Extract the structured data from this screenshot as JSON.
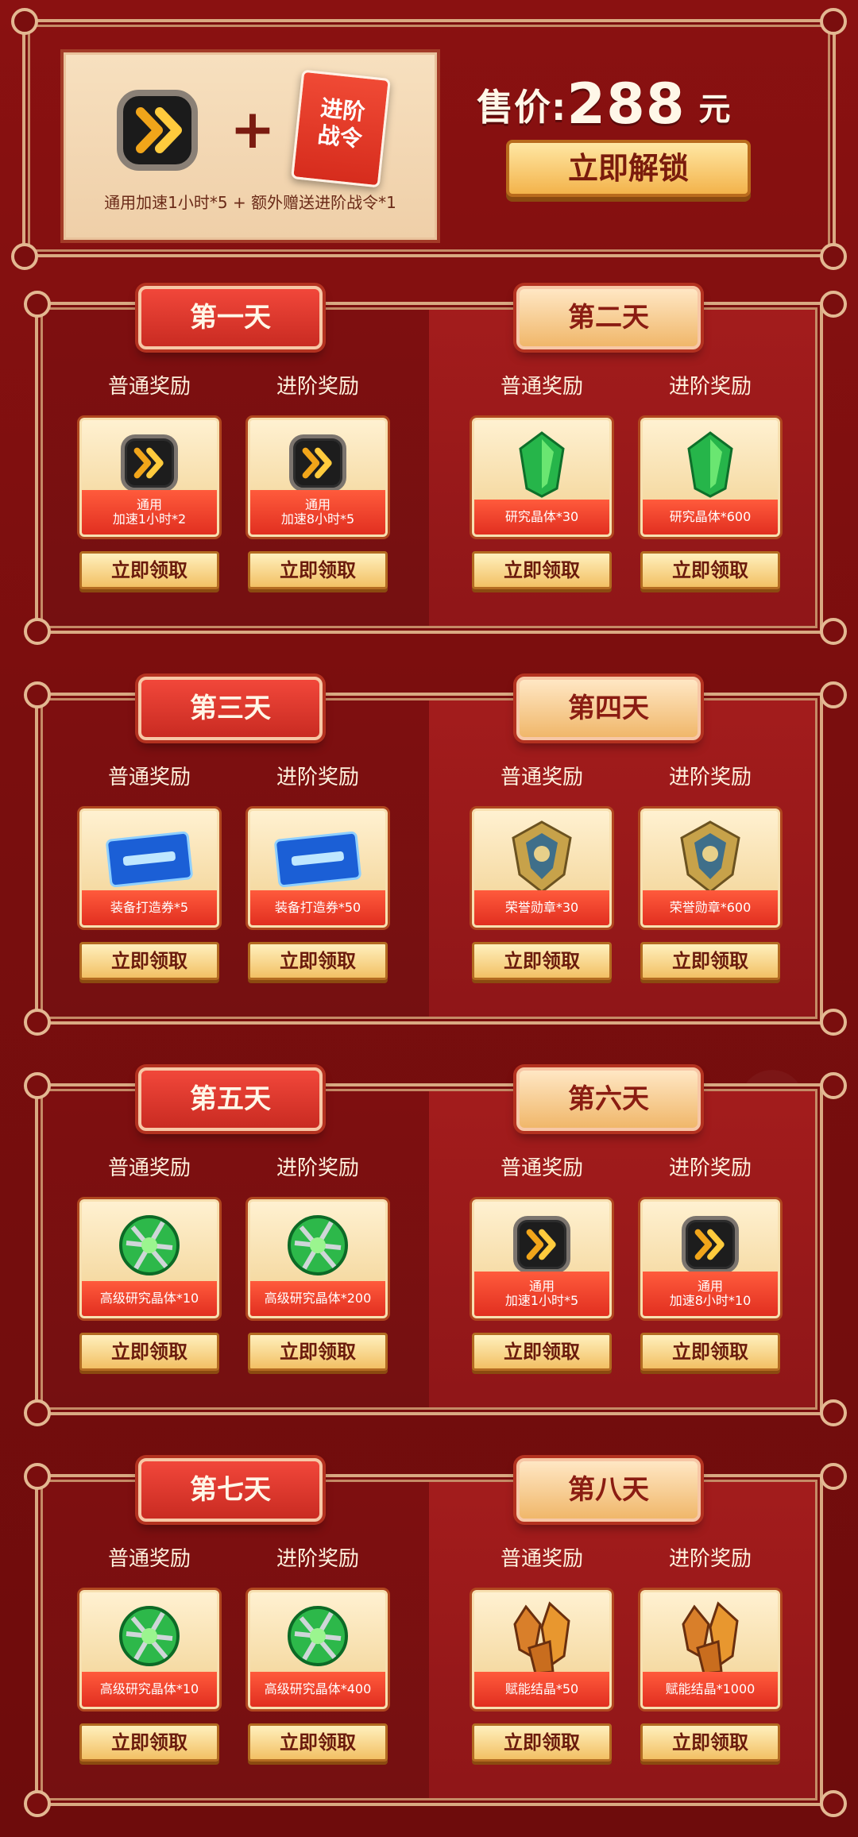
{
  "purchase": {
    "caption": "通用加速1小时*5 + 额外赠送进阶战令*1",
    "plus": "+",
    "token_text": "进阶\n战令",
    "price_label": "售价:",
    "price_value": "288",
    "price_unit": "元",
    "unlock_label": "立即解锁"
  },
  "labels": {
    "normal": "普通奖励",
    "advanced": "进阶奖励",
    "claim": "立即领取"
  },
  "rows": [
    {
      "left": {
        "title": "第一天",
        "normal": {
          "icon": "speed-icon",
          "text_top": "通用",
          "text": "加速1小时*2"
        },
        "advanced": {
          "icon": "speed-icon",
          "text_top": "通用",
          "text": "加速8小时*5"
        }
      },
      "right": {
        "title": "第二天",
        "normal": {
          "icon": "crystal-icon",
          "text": "研究晶体*30"
        },
        "advanced": {
          "icon": "crystal-icon",
          "text": "研究晶体*600"
        }
      }
    },
    {
      "left": {
        "title": "第三天",
        "normal": {
          "icon": "ticket-icon",
          "text": "装备打造券*5"
        },
        "advanced": {
          "icon": "ticket-icon",
          "text": "装备打造券*50"
        }
      },
      "right": {
        "title": "第四天",
        "normal": {
          "icon": "medal-icon",
          "text": "荣誉勋章*30"
        },
        "advanced": {
          "icon": "medal-icon",
          "text": "荣誉勋章*600"
        }
      }
    },
    {
      "left": {
        "title": "第五天",
        "normal": {
          "icon": "advanced-crystal-icon",
          "text": "高级研究晶体*10"
        },
        "advanced": {
          "icon": "advanced-crystal-icon",
          "text": "高级研究晶体*200"
        }
      },
      "right": {
        "title": "第六天",
        "normal": {
          "icon": "speed-icon",
          "text_top": "通用",
          "text": "加速1小时*5"
        },
        "advanced": {
          "icon": "speed-icon",
          "text_top": "通用",
          "text": "加速8小时*10"
        }
      }
    },
    {
      "left": {
        "title": "第七天",
        "normal": {
          "icon": "advanced-crystal-icon",
          "text": "高级研究晶体*10"
        },
        "advanced": {
          "icon": "advanced-crystal-icon",
          "text": "高级研究晶体*400"
        }
      },
      "right": {
        "title": "第八天",
        "normal": {
          "icon": "energy-crystal-icon",
          "text": "赋能结晶*50"
        },
        "advanced": {
          "icon": "energy-crystal-icon",
          "text": "赋能结晶*1000"
        }
      }
    }
  ]
}
